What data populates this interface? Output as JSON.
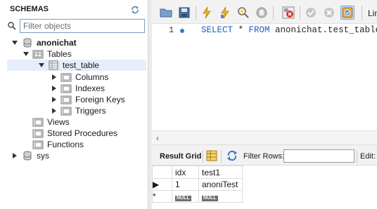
{
  "navigator": {
    "title": "SCHEMAS",
    "filter_placeholder": "Filter objects",
    "tree": [
      {
        "label": "anonichat",
        "bold": true,
        "expanded": true,
        "icon": "database-icon"
      },
      {
        "label": "Tables",
        "expanded": true,
        "icon": "folder-tables-icon"
      },
      {
        "label": "test_table",
        "expanded": true,
        "icon": "table-icon",
        "selected": true
      },
      {
        "label": "Columns",
        "expanded": false,
        "icon": "folder-columns-icon"
      },
      {
        "label": "Indexes",
        "expanded": false,
        "icon": "folder-indexes-icon"
      },
      {
        "label": "Foreign Keys",
        "expanded": false,
        "icon": "folder-fk-icon"
      },
      {
        "label": "Triggers",
        "expanded": false,
        "icon": "folder-triggers-icon"
      },
      {
        "label": "Views",
        "icon": "folder-views-icon"
      },
      {
        "label": "Stored Procedures",
        "icon": "folder-procedures-icon"
      },
      {
        "label": "Functions",
        "icon": "folder-functions-icon"
      },
      {
        "label": "sys",
        "expanded": false,
        "icon": "database-icon"
      }
    ]
  },
  "toolbar": {
    "limit_label": "Lim",
    "buttons": [
      "open-file-icon",
      "save-icon",
      "execute-icon",
      "execute-current-icon",
      "explain-icon",
      "stop-icon",
      "toggle-error-icon",
      "commit-icon",
      "rollback-icon",
      "autocommit-icon"
    ]
  },
  "editor": {
    "line_number": "1",
    "code": {
      "kw1": "SELECT",
      "star": " * ",
      "kw2": "FROM",
      "rest": " anonichat.test_table;"
    }
  },
  "result_bar": {
    "result_grid_label": "Result Grid",
    "filter_rows_label": "Filter Rows:",
    "edit_label": "Edit:"
  },
  "grid": {
    "columns": [
      "idx",
      "test1"
    ],
    "rows": [
      {
        "marker": "▶",
        "cells": [
          "1",
          "anoniTest"
        ]
      },
      {
        "marker": "*",
        "cells": [
          "NULL",
          "NULL"
        ],
        "null": true
      }
    ]
  },
  "colors": {
    "keyword": "#1f5fc4",
    "selection": "#e5eefa",
    "gutter_dot": "#2a7bd4"
  }
}
